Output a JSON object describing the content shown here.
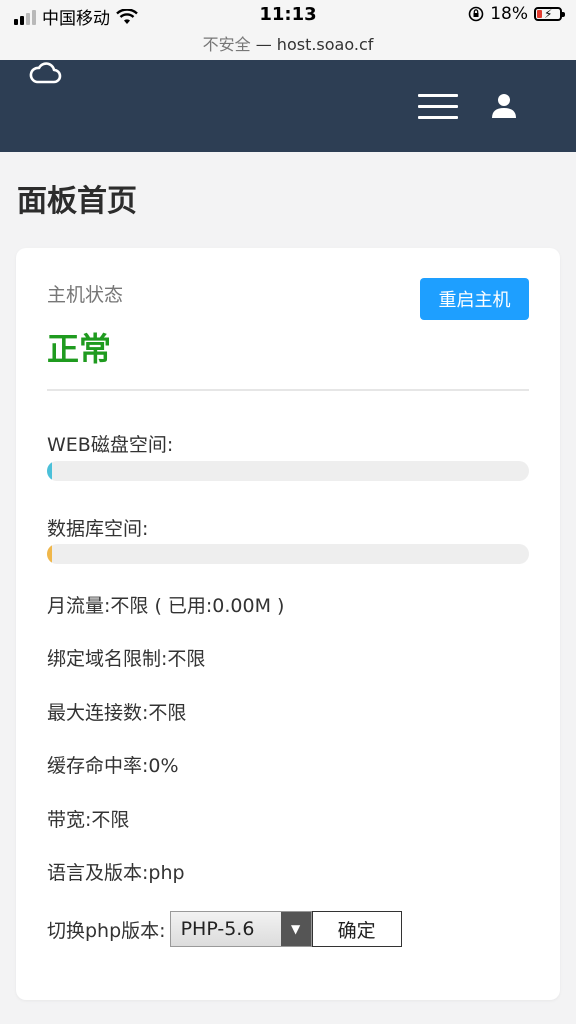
{
  "status_bar": {
    "carrier": "中国移动",
    "time": "11:13",
    "battery": "18%",
    "battery_level": 0.18
  },
  "address_bar": {
    "security": "不安全",
    "separator": " — ",
    "host": "host.soao.cf"
  },
  "navbar": {
    "logo_icon": "cloud-icon",
    "menu_icon": "hamburger-menu-icon",
    "user_icon": "user-icon",
    "bg_color": "#2d3e54"
  },
  "page": {
    "title": "面板首页"
  },
  "host_status": {
    "label": "主机状态",
    "value": "正常",
    "restart_button": "重启主机",
    "value_color": "#1f9b1f",
    "button_color": "#1e9fff"
  },
  "web_disk": {
    "label": "WEB磁盘空间:",
    "usage_fraction": 0.01,
    "color": "#4bc0d9"
  },
  "db_space": {
    "label": "数据库空间:",
    "usage_fraction": 0.01,
    "color": "#f0b74a"
  },
  "info_rows": [
    "月流量:不限 ( 已用:0.00M )",
    "绑定域名限制:不限",
    "最大连接数:不限",
    "缓存命中率:0%",
    "带宽:不限",
    "语言及版本:php"
  ],
  "php_switch": {
    "label": "切换php版本:",
    "selected": "PHP-5.6",
    "confirm_button": "确定"
  }
}
